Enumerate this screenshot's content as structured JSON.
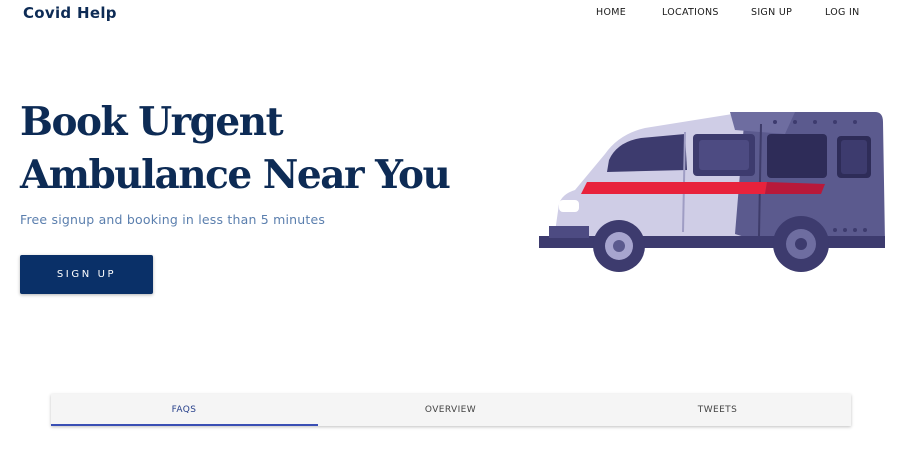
{
  "header": {
    "brand": "Covid Help",
    "nav": [
      {
        "label": "HOME"
      },
      {
        "label": "LOCATIONS"
      },
      {
        "label": "SIGN UP"
      },
      {
        "label": "LOG IN"
      }
    ]
  },
  "hero": {
    "title_line1": "Book Urgent",
    "title_line2": "Ambulance Near You",
    "subtitle": "Free signup and booking in less than 5 minutes",
    "cta_label": "SIGN UP",
    "illustration": "ambulance-van-icon"
  },
  "tabs": {
    "items": [
      {
        "label": "FAQS"
      },
      {
        "label": "OVERVIEW"
      },
      {
        "label": "TWEETS"
      }
    ],
    "active": "FAQS"
  },
  "colors": {
    "brand_navy": "#0d2b55",
    "button_bg": "#0a3068",
    "subtitle_blue": "#5b7fae",
    "tab_active": "#3a4fb4",
    "tab_bar_bg": "#f5f5f5",
    "ambulance_stripe": "#e8223c",
    "ambulance_body": "#5b5a8e"
  }
}
